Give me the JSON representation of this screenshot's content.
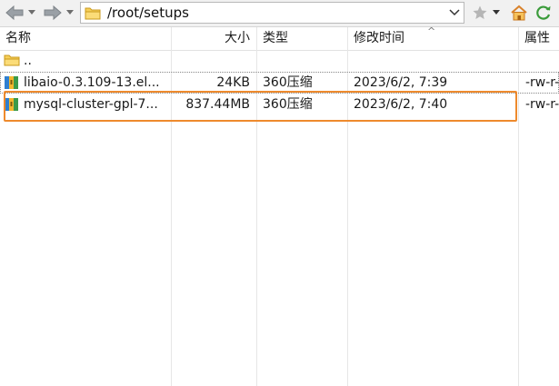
{
  "toolbar": {
    "path": "/root/setups",
    "icons": {
      "back": "back-arrow-icon",
      "forward": "forward-arrow-icon",
      "folder": "folder-icon",
      "bookmark": "star-icon",
      "home": "home-icon",
      "refresh": "refresh-icon"
    }
  },
  "columns": {
    "name": "名称",
    "size": "大小",
    "type": "类型",
    "modified": "修改时间",
    "attributes": "属性"
  },
  "rows": [
    {
      "name": "..",
      "size": "",
      "type": "",
      "modified": "",
      "attributes": "",
      "icon": "parent-folder-icon"
    },
    {
      "name": "libaio-0.3.109-13.el...",
      "size": "24KB",
      "type": "360压缩",
      "modified": "2023/6/2, 7:39",
      "attributes": "-rw-r-",
      "icon": "archive-icon"
    },
    {
      "name": "mysql-cluster-gpl-7...",
      "size": "837.44MB",
      "type": "360压缩",
      "modified": "2023/6/2, 7:40",
      "attributes": "-rw-r-",
      "icon": "archive-icon"
    }
  ],
  "colors": {
    "highlight": "#ee8a2d",
    "folder": "#f4c542"
  }
}
